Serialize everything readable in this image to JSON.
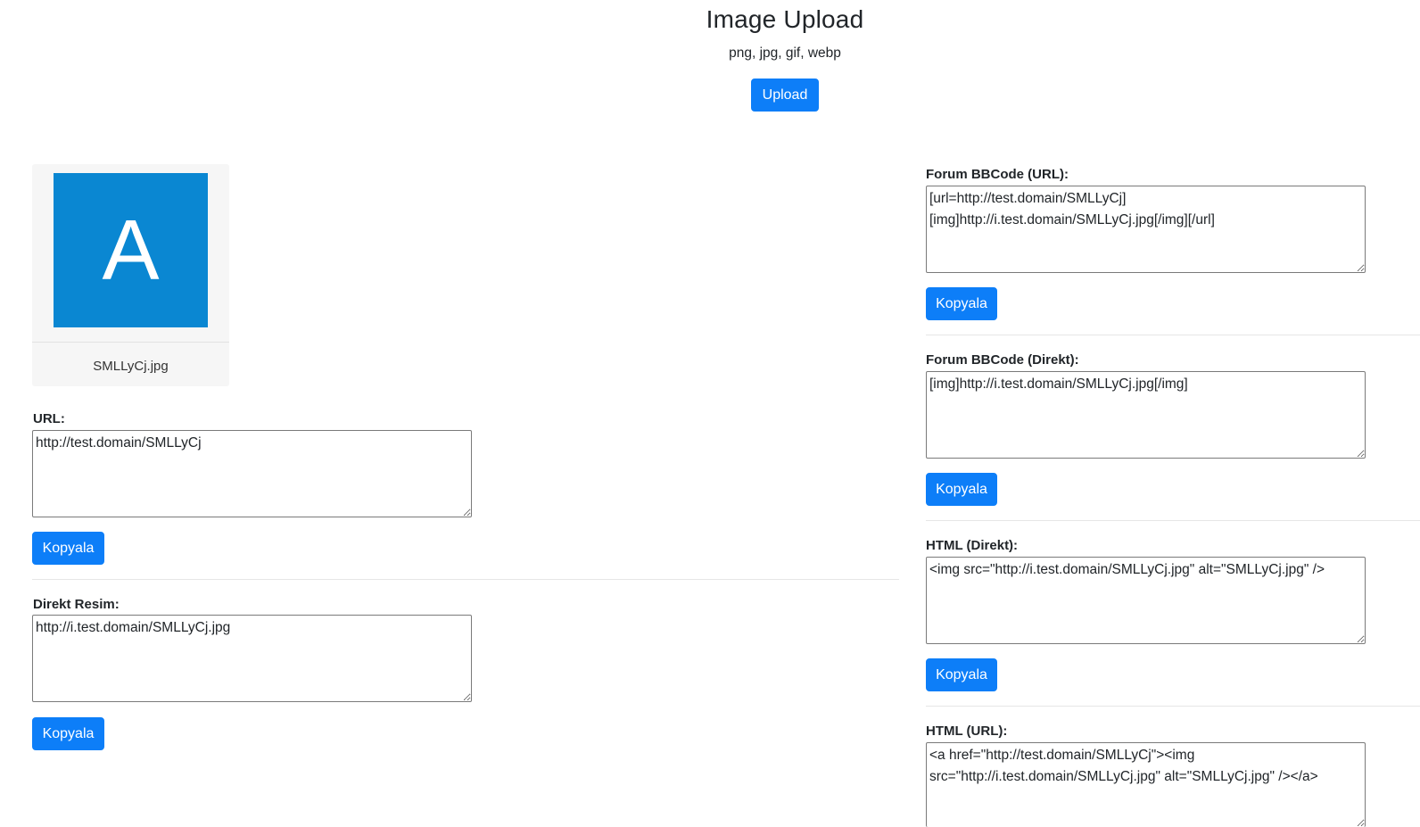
{
  "header": {
    "title": "Image Upload",
    "formats": "png, jpg, gif, webp",
    "upload_label": "Upload"
  },
  "preview": {
    "thumbnail_letter": "A",
    "thumbnail_color": "#0a87d2",
    "filename": "SMLLyCj.jpg"
  },
  "fields": {
    "url": {
      "label": "URL:",
      "value": "http://test.domain/SMLLyCj"
    },
    "direct_image": {
      "label": "Direkt Resim:",
      "value": "http://i.test.domain/SMLLyCj.jpg"
    },
    "forum_bbcode_url": {
      "label": "Forum BBCode (URL):",
      "value": "[url=http://test.domain/SMLLyCj]\n[img]http://i.test.domain/SMLLyCj.jpg[/img][/url]"
    },
    "forum_bbcode_direct": {
      "label": "Forum BBCode (Direkt):",
      "value": "[img]http://i.test.domain/SMLLyCj.jpg[/img]"
    },
    "html_direct": {
      "label": "HTML (Direkt):",
      "value": "<img src=\"http://i.test.domain/SMLLyCj.jpg\" alt=\"SMLLyCj.jpg\" />"
    },
    "html_url": {
      "label": "HTML (URL):",
      "value": "<a href=\"http://test.domain/SMLLyCj\"><img\nsrc=\"http://i.test.domain/SMLLyCj.jpg\" alt=\"SMLLyCj.jpg\" /></a>"
    }
  },
  "copy_label": "Kopyala",
  "colors": {
    "accent": "#0d7ef8"
  }
}
